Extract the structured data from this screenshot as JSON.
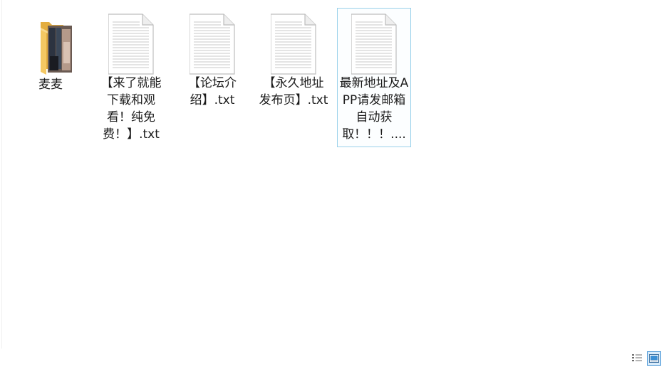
{
  "files": [
    {
      "name": "麦麦",
      "type": "folder",
      "icon": "folder-icon"
    },
    {
      "name": "【来了就能下载和观看！纯免费！】.txt",
      "type": "txt",
      "icon": "text-file-icon"
    },
    {
      "name": "【论坛介绍】.txt",
      "type": "txt",
      "icon": "text-file-icon"
    },
    {
      "name": "【永久地址发布页】.txt",
      "type": "txt",
      "icon": "text-file-icon"
    },
    {
      "name": "最新地址及APP请发邮箱自动获取！！！....",
      "type": "txt",
      "icon": "text-file-icon",
      "selected": true
    }
  ],
  "view_toggles": [
    {
      "icon": "details-view-icon",
      "active": false
    },
    {
      "icon": "large-icons-view-icon",
      "active": true
    }
  ],
  "colors": {
    "selection_border": "#99d1ea",
    "folder": "#f4c863",
    "active_toggle": "#3c8fd4"
  }
}
